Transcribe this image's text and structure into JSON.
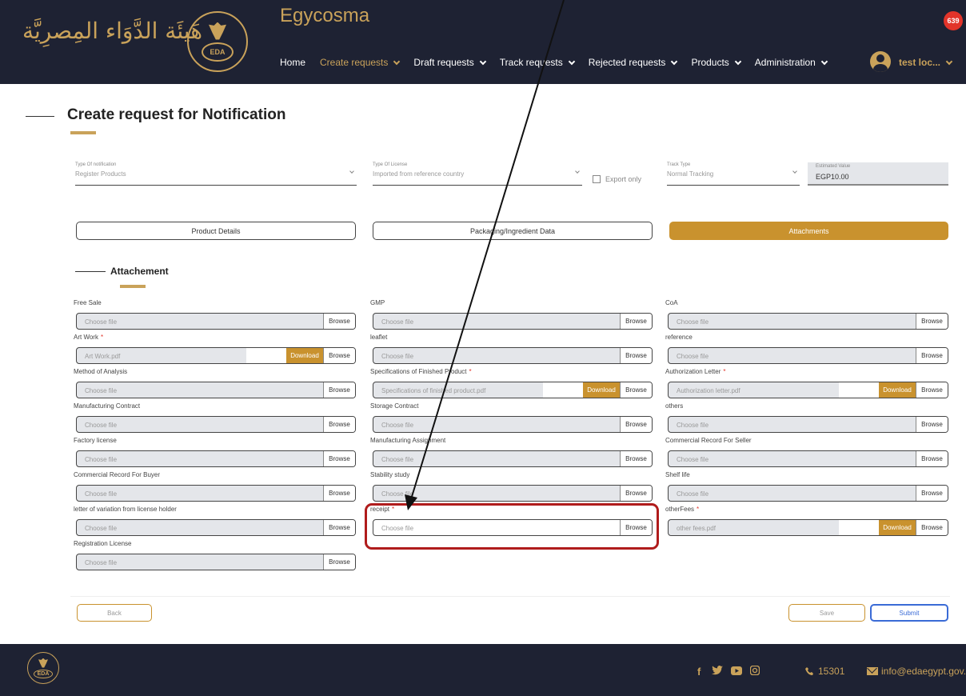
{
  "header": {
    "arabic_logo": "هَيئَة الدَّوَاء المِصرِيَّة",
    "emblem_text": "EDA",
    "app_title": "Egycosma",
    "nav": [
      {
        "label": "Home",
        "dropdown": false,
        "active": false
      },
      {
        "label": "Create requests",
        "dropdown": true,
        "active": true
      },
      {
        "label": "Draft requests",
        "dropdown": true,
        "active": false
      },
      {
        "label": "Track requests",
        "dropdown": true,
        "active": false
      },
      {
        "label": "Rejected requests",
        "dropdown": true,
        "active": false
      },
      {
        "label": "Products",
        "dropdown": true,
        "active": false
      },
      {
        "label": "Administration",
        "dropdown": true,
        "active": false
      }
    ],
    "user_name": "test loc...",
    "notification_count": "639",
    "accent_color": "#c9a25a",
    "bg_color": "#1e2233"
  },
  "page": {
    "title": "Create request for Notification"
  },
  "form": {
    "type_of_notification": {
      "label": "Type Of notification",
      "value": "Register Products"
    },
    "type_of_license": {
      "label": "Type Of License",
      "value": "Imported from reference country"
    },
    "export_only": {
      "label": "Export only",
      "checked": false
    },
    "track_type": {
      "label": "Track Type",
      "value": "Normal Tracking"
    },
    "estimated_value": {
      "label": "Estimated Value",
      "value": "EGP10.00"
    }
  },
  "tabs": [
    {
      "label": "Product Details",
      "active": false
    },
    {
      "label": "Packaging/Ingredient Data",
      "active": false
    },
    {
      "label": "Attachments",
      "active": true
    }
  ],
  "section": {
    "title": "Attachement"
  },
  "common": {
    "browse": "Browse",
    "download": "Download"
  },
  "attachments": {
    "col1": [
      {
        "label": "Free Sale",
        "required": false,
        "value": "Choose file",
        "has_download": false
      },
      {
        "label": "Art Work",
        "required": true,
        "value": "Art Work.pdf",
        "has_download": true
      },
      {
        "label": "Method of Analysis",
        "required": false,
        "value": "Choose file",
        "has_download": false
      },
      {
        "label": "Manufacturing Contract",
        "required": false,
        "value": "Choose file",
        "has_download": false
      },
      {
        "label": "Factory license",
        "required": false,
        "value": "Choose file",
        "has_download": false
      },
      {
        "label": "Commercial Record For Buyer",
        "required": false,
        "value": "Choose file",
        "has_download": false
      },
      {
        "label": "letter of variation from license holder",
        "required": false,
        "value": "Choose file",
        "has_download": false
      },
      {
        "label": "Registration License",
        "required": false,
        "value": "Choose file",
        "has_download": false
      }
    ],
    "col2": [
      {
        "label": "GMP",
        "required": false,
        "value": "Choose file",
        "has_download": false
      },
      {
        "label": "leaflet",
        "required": false,
        "value": "Choose file",
        "has_download": false
      },
      {
        "label": "Specifications of Finished Product",
        "required": true,
        "value": "Specifications of finished product.pdf",
        "has_download": true
      },
      {
        "label": "Storage Contract",
        "required": false,
        "value": "Choose file",
        "has_download": false
      },
      {
        "label": "Manufacturing Assignment",
        "required": false,
        "value": "Choose file",
        "has_download": false
      },
      {
        "label": "Stability study",
        "required": false,
        "value": "Choose file",
        "has_download": false
      },
      {
        "label": "receipt",
        "required": true,
        "value": "Choose file",
        "has_download": false
      }
    ],
    "col3": [
      {
        "label": "CoA",
        "required": false,
        "value": "Choose file",
        "has_download": false
      },
      {
        "label": "reference",
        "required": false,
        "value": "Choose file",
        "has_download": false
      },
      {
        "label": "Authorization Letter",
        "required": true,
        "value": "Authorization letter.pdf",
        "has_download": true
      },
      {
        "label": "others",
        "required": false,
        "value": "Choose file",
        "has_download": false
      },
      {
        "label": "Commercial Record For Seller",
        "required": false,
        "value": "Choose file",
        "has_download": false
      },
      {
        "label": "Shelf life",
        "required": false,
        "value": "Choose file",
        "has_download": false
      },
      {
        "label": "otherFees",
        "required": true,
        "value": "other fees.pdf",
        "has_download": true
      }
    ]
  },
  "actions": {
    "back": "Back",
    "save": "Save",
    "submit": "Submit"
  },
  "footer": {
    "emblem_text": "EDA",
    "social_icons": [
      "facebook-icon",
      "twitter-icon",
      "youtube-icon",
      "instagram-icon"
    ],
    "phone": "15301",
    "email": "info@edaegypt.gov.eg"
  },
  "annotation": {
    "highlight_target": "receipt",
    "highlight_color": "#b01c1c"
  }
}
